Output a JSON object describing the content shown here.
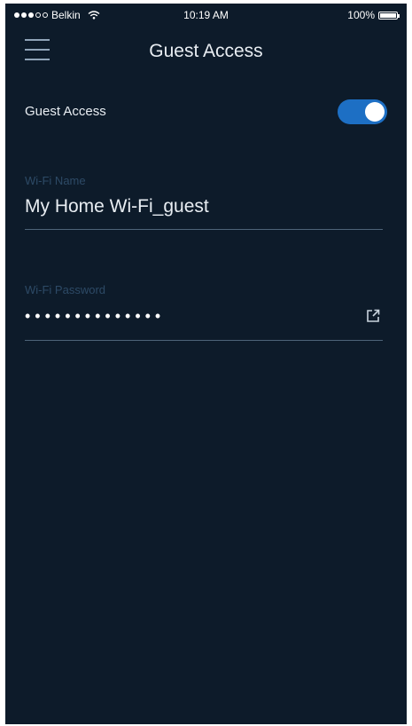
{
  "status_bar": {
    "carrier": "Belkin",
    "time": "10:19 AM",
    "battery": "100%"
  },
  "header": {
    "title": "Guest Access",
    "menu_icon": "hamburger-menu-icon"
  },
  "guest_access": {
    "label": "Guest Access",
    "enabled": true
  },
  "wifi_name": {
    "label": "Wi-Fi Name",
    "value": "My Home Wi-Fi_guest"
  },
  "wifi_password": {
    "label": "Wi-Fi Password",
    "masked_value": "••••••••••••••",
    "action_icon": "share-icon"
  },
  "colors": {
    "background": "#0d1b2a",
    "toggle_on": "#1d6fc4",
    "label_dim": "#2d4a66",
    "divider": "#4e6478"
  }
}
